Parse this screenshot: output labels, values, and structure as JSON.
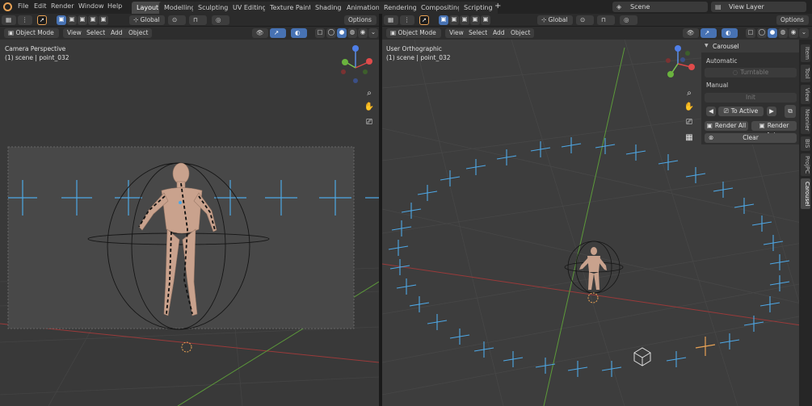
{
  "menu": [
    "File",
    "Edit",
    "Render",
    "Window",
    "Help"
  ],
  "workspaces": [
    "Layout",
    "Modelling",
    "Sculpting",
    "UV Editing",
    "Texture Paint",
    "Shading",
    "Animation",
    "Rendering",
    "Compositing",
    "Scripting"
  ],
  "workspace_add": "+",
  "scene_field": "Scene",
  "view_layer_field": "View Layer",
  "left": {
    "transform": "Global",
    "options": "Options",
    "mode": "Object Mode",
    "menus": [
      "View",
      "Select",
      "Add",
      "Object"
    ],
    "view_name": "Camera Perspective",
    "collection": "(1) scene | point_032"
  },
  "right": {
    "transform": "Global",
    "options": "Options",
    "mode": "Object Mode",
    "menus": [
      "View",
      "Select",
      "Add",
      "Object"
    ],
    "view_name": "User Orthographic",
    "collection": "(1) scene | point_032"
  },
  "carousel_panel": {
    "title": "Carousel",
    "automatic_label": "Automatic",
    "turntable_label": "Turntable",
    "manual_label": "Manual",
    "init_label": "Init",
    "to_active_label": "To Active",
    "render_all_label": "Render All",
    "render_active_label": "Render Act...",
    "clear_label": "Clear"
  },
  "side_tabs": [
    "Item",
    "Tool",
    "View",
    "Neonier",
    "BIS",
    "ProjPC",
    "Carousel"
  ],
  "colors": {
    "accent_blue": "#4772b3",
    "marker_blue": "#4ea8e6",
    "axis_red": "#9a3a3a",
    "axis_green": "#5c9a3a",
    "workspace_active": "#4a4a4a"
  }
}
